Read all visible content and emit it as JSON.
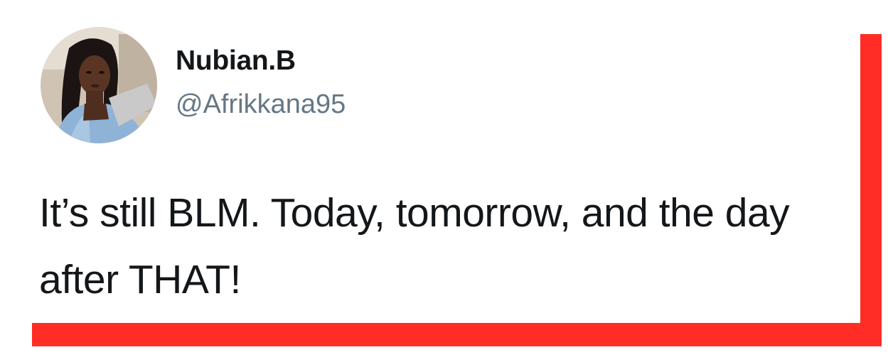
{
  "tweet": {
    "display_name": "Nubian.B",
    "handle": "@Afrikkana95",
    "text": "It’s still BLM. Today, tomorrow, and the day after THAT!"
  },
  "colors": {
    "accent_frame": "#ff2d25",
    "name_text": "#14171a",
    "handle_text": "#657786",
    "background": "#ffffff"
  }
}
